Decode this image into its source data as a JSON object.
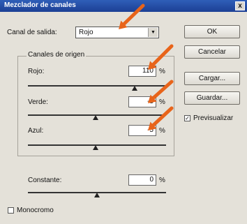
{
  "window": {
    "title": "Mezclador de canales",
    "close_glyph": "x"
  },
  "output": {
    "label": "Canal de salida:",
    "value": "Rojo"
  },
  "source_group": {
    "label": "Canales de origen",
    "channels": [
      {
        "label": "Rojo:",
        "value": "110",
        "unit": "%",
        "level": 1.1
      },
      {
        "label": "Verde:",
        "value": "-5",
        "unit": "%",
        "level": -0.05
      },
      {
        "label": "Azul:",
        "value": "-5",
        "unit": "%",
        "level": -0.05
      }
    ]
  },
  "constant": {
    "label": "Constante:",
    "value": "0",
    "unit": "%",
    "level": 0
  },
  "monochrome": {
    "label": "Monocromo",
    "checked": false
  },
  "buttons": {
    "ok": "OK",
    "cancel": "Cancelar",
    "load": "Cargar...",
    "save": "Guardar..."
  },
  "preview": {
    "label": "Previsualizar",
    "checked": true,
    "mark": "✓"
  },
  "colors": {
    "arrow": "#e8641a",
    "titlebar": "#2350a8"
  },
  "annotations": {
    "arrows": 4
  }
}
